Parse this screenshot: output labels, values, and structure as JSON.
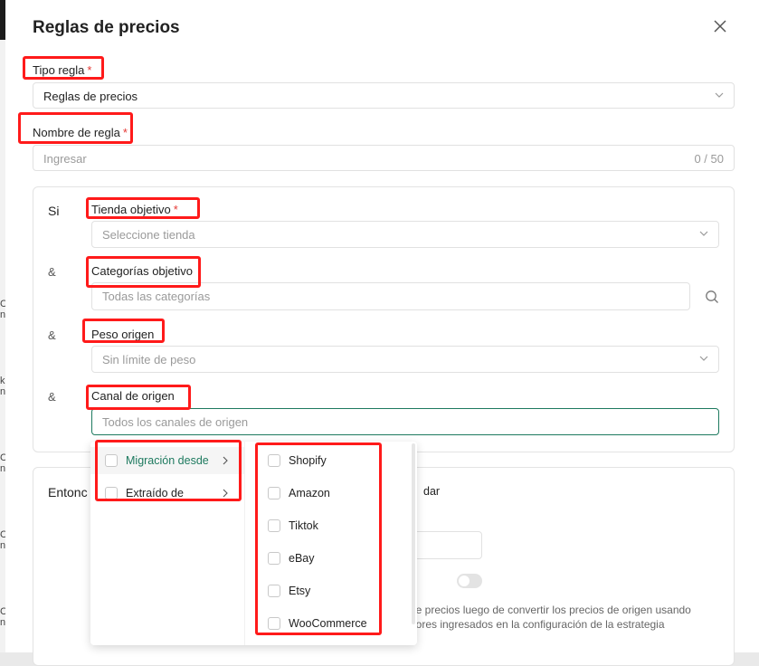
{
  "modal": {
    "title": "Reglas de precios",
    "close_icon": "close-icon"
  },
  "rule_type": {
    "label": "Tipo regla",
    "required_mark": "*",
    "value": "Reglas de precios"
  },
  "rule_name": {
    "label": "Nombre de regla",
    "required_mark": "*",
    "placeholder": "Ingresar",
    "counter": "0 / 50"
  },
  "conditions": {
    "if_label": "Si",
    "and_symbol": "&",
    "target_store": {
      "label": "Tienda objetivo",
      "required_mark": "*",
      "placeholder": "Seleccione tienda"
    },
    "target_categories": {
      "label": "Categorías objetivo",
      "placeholder": "Todas las categorías",
      "search_icon": "search-icon"
    },
    "source_weight": {
      "label": "Peso origen",
      "placeholder": "Sin límite de peso"
    },
    "source_channel": {
      "label": "Canal de origen",
      "placeholder": "Todos los canales de origen"
    }
  },
  "then_section": {
    "label_partial": "Entonc",
    "text_partial_right": "dar",
    "description_line1": "le precios luego de convertir los precios de origen usando",
    "description_line2": "lores ingresados en la configuración de la estrategia"
  },
  "channel_dropdown": {
    "groups": [
      {
        "label": "Migración desde",
        "active": true
      },
      {
        "label": "Extraído de",
        "active": false
      }
    ],
    "options": [
      "Shopify",
      "Amazon",
      "Tiktok",
      "eBay",
      "Etsy",
      "WooCommerce"
    ]
  },
  "colors": {
    "accent": "#1e7a5f",
    "required": "#e53935",
    "highlight": "#ff1a1a"
  }
}
